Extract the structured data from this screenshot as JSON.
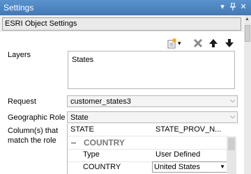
{
  "window": {
    "title": "Settings",
    "buttons": {
      "menu": "▾",
      "pin": "📌",
      "close": "✕"
    }
  },
  "section": {
    "title": "ESRI Object Settings"
  },
  "toolbar": {
    "icons": [
      "new-layer-icon",
      "dropdown-arrow-icon",
      "delete-icon",
      "move-up-icon",
      "move-down-icon"
    ],
    "dropdown_glyph": "▾",
    "up_glyph": "🡅",
    "down_glyph": "🡇"
  },
  "layers": {
    "label": "Layers",
    "items": [
      "States"
    ]
  },
  "request": {
    "label": "Request",
    "value": "customer_states3"
  },
  "geographic_role": {
    "label": "Geographic Role",
    "value": "State"
  },
  "columns": {
    "label": "Column(s) that match the role",
    "header": [
      "STATE",
      "STATE_PROV_N..."
    ],
    "group": {
      "symbol": "−",
      "name": "COUNTRY"
    },
    "rows": [
      {
        "name": "Type",
        "value": "User Defined"
      },
      {
        "name": "COUNTRY",
        "value": "United States"
      }
    ]
  },
  "glyphs": {
    "combo_arrow": "⌵"
  }
}
